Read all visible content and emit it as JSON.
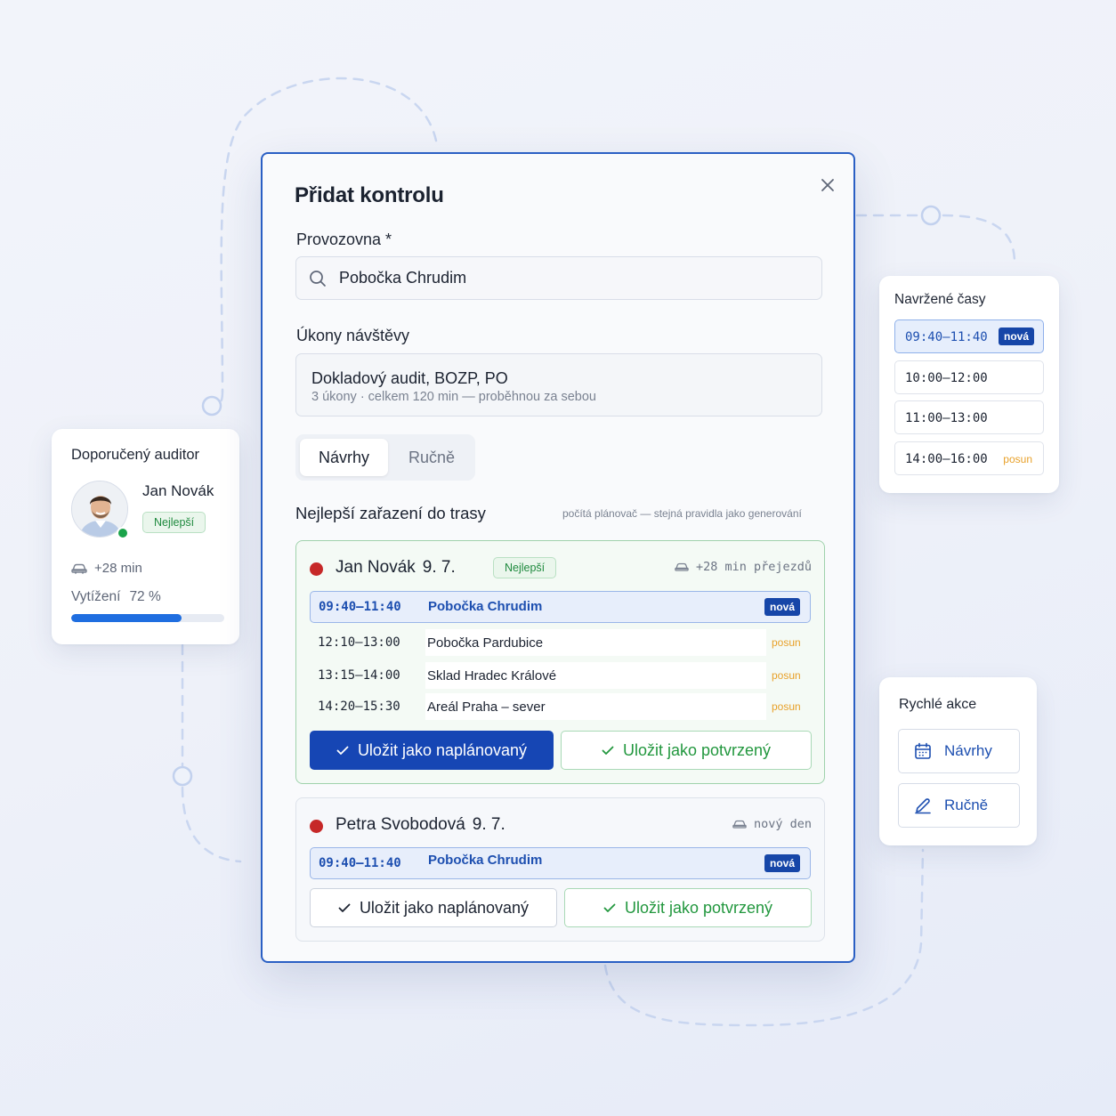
{
  "colors": {
    "accent": "#1646b4",
    "accent_light": "#e7eefb",
    "success": "#22973e",
    "warning": "#e8a12a",
    "danger_dot": "#c62828",
    "online_dot": "#1aa34a"
  },
  "auditor_card": {
    "title": "Doporučený auditor",
    "name": "Jan Novák",
    "badge": "Nejlepší",
    "travel": "+28 min",
    "load_label": "Vytížení",
    "load_value": "72 %",
    "load_fraction": 0.72
  },
  "modal": {
    "title": "Přidat kontrolu",
    "facility_label": "Provozovna *",
    "facility_value": "Pobočka Chrudim",
    "tasks_label": "Úkony návštěvy",
    "tasks_value": "Dokladový audit, BOZP, PO",
    "tasks_meta": "3 úkony · celkem 120 min — proběhnou za sebou",
    "tabs": [
      {
        "label": "Návrhy",
        "active": true
      },
      {
        "label": "Ručně",
        "active": false
      }
    ],
    "section_title": "Nejlepší zařazení do trasy",
    "section_note": "počítá plánovač — stejná pravidla jako generování",
    "route1": {
      "auditor": "Jan Novák",
      "date": "9. 7.",
      "badge": "Nejlepší",
      "travel": "+28 min přejezdů",
      "new_slot": {
        "time": "09:40–11:40",
        "place": "Pobočka Chrudim",
        "tag": "nová"
      },
      "rows": [
        {
          "time": "12:10–13:00",
          "place": "Pobočka Pardubice",
          "tag": "posun"
        },
        {
          "time": "13:15–14:00",
          "place": "Sklad Hradec Králové",
          "tag": "posun"
        },
        {
          "time": "14:20–15:30",
          "place": "Areál Praha – sever",
          "tag": "posun"
        }
      ],
      "btn_planned": "Uložit jako naplánovaný",
      "btn_confirmed": "Uložit jako potvrzený"
    },
    "route2": {
      "auditor": "Petra Svobodová",
      "date": "9. 7.",
      "travel": "nový den",
      "new_slot": {
        "time": "09:40–11:40",
        "place": "Pobočka Chrudim",
        "tag": "nová"
      },
      "btn_planned": "Uložit jako naplánovaný",
      "btn_confirmed": "Uložit jako potvrzený"
    }
  },
  "suggested_times": {
    "title": "Navržené časy",
    "options": [
      {
        "time": "09:40–11:40",
        "tag": "nová",
        "selected": true
      },
      {
        "time": "10:00–12:00",
        "tag": "",
        "selected": false
      },
      {
        "time": "11:00–13:00",
        "tag": "",
        "selected": false
      },
      {
        "time": "14:00–16:00",
        "tag": "posun",
        "selected": false
      }
    ]
  },
  "quick_actions": {
    "title": "Rychlé akce",
    "items": [
      {
        "label": "Návrhy",
        "icon": "calendar-icon"
      },
      {
        "label": "Ručně",
        "icon": "pencil-icon"
      }
    ]
  }
}
